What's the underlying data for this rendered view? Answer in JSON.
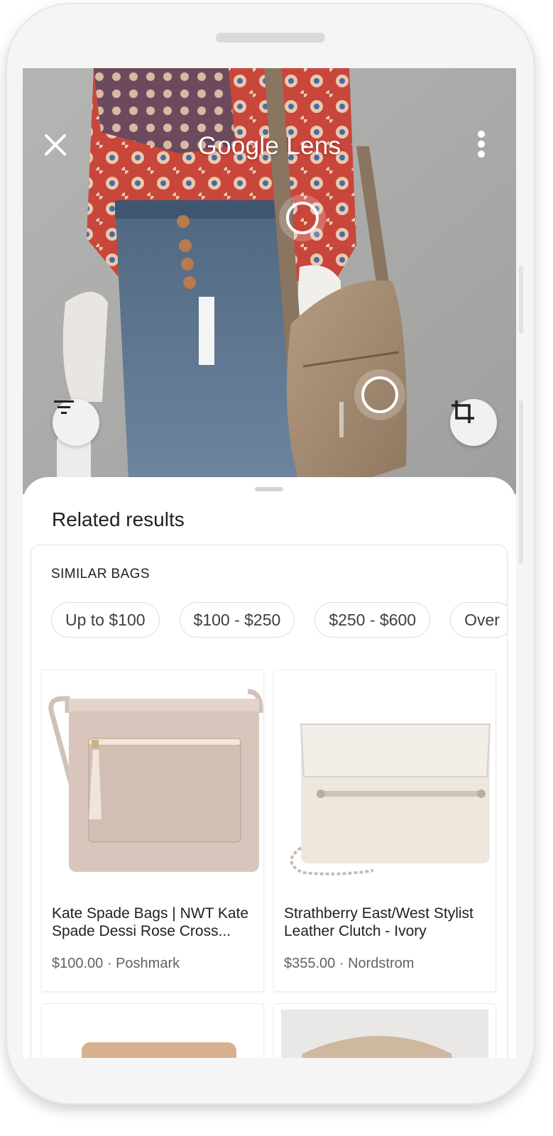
{
  "app": {
    "title": "Google Lens"
  },
  "sheet": {
    "title": "Related results",
    "section_title": "SIMILAR BAGS",
    "price_filters": [
      "Up to $100",
      "$100 - $250",
      "$250 - $600",
      "Over"
    ]
  },
  "products": [
    {
      "title": "Kate Spade Bags | NWT Kate Spade Dessi Rose Cross...",
      "price": "$100.00",
      "seller": "Poshmark",
      "meta": "$100.00 · Poshmark"
    },
    {
      "title": "Strathberry East/West Stylist Leather Clutch - Ivory",
      "price": "$355.00",
      "seller": "Nordstrom",
      "meta": "$355.00 · Nordstrom"
    }
  ],
  "icons": {
    "close": "close-icon",
    "more": "more-vert-icon",
    "filter": "filter-icon",
    "crop": "crop-icon"
  },
  "colors": {
    "text_primary": "#202124",
    "text_secondary": "#5f6368",
    "chip_border": "#dadce0"
  }
}
